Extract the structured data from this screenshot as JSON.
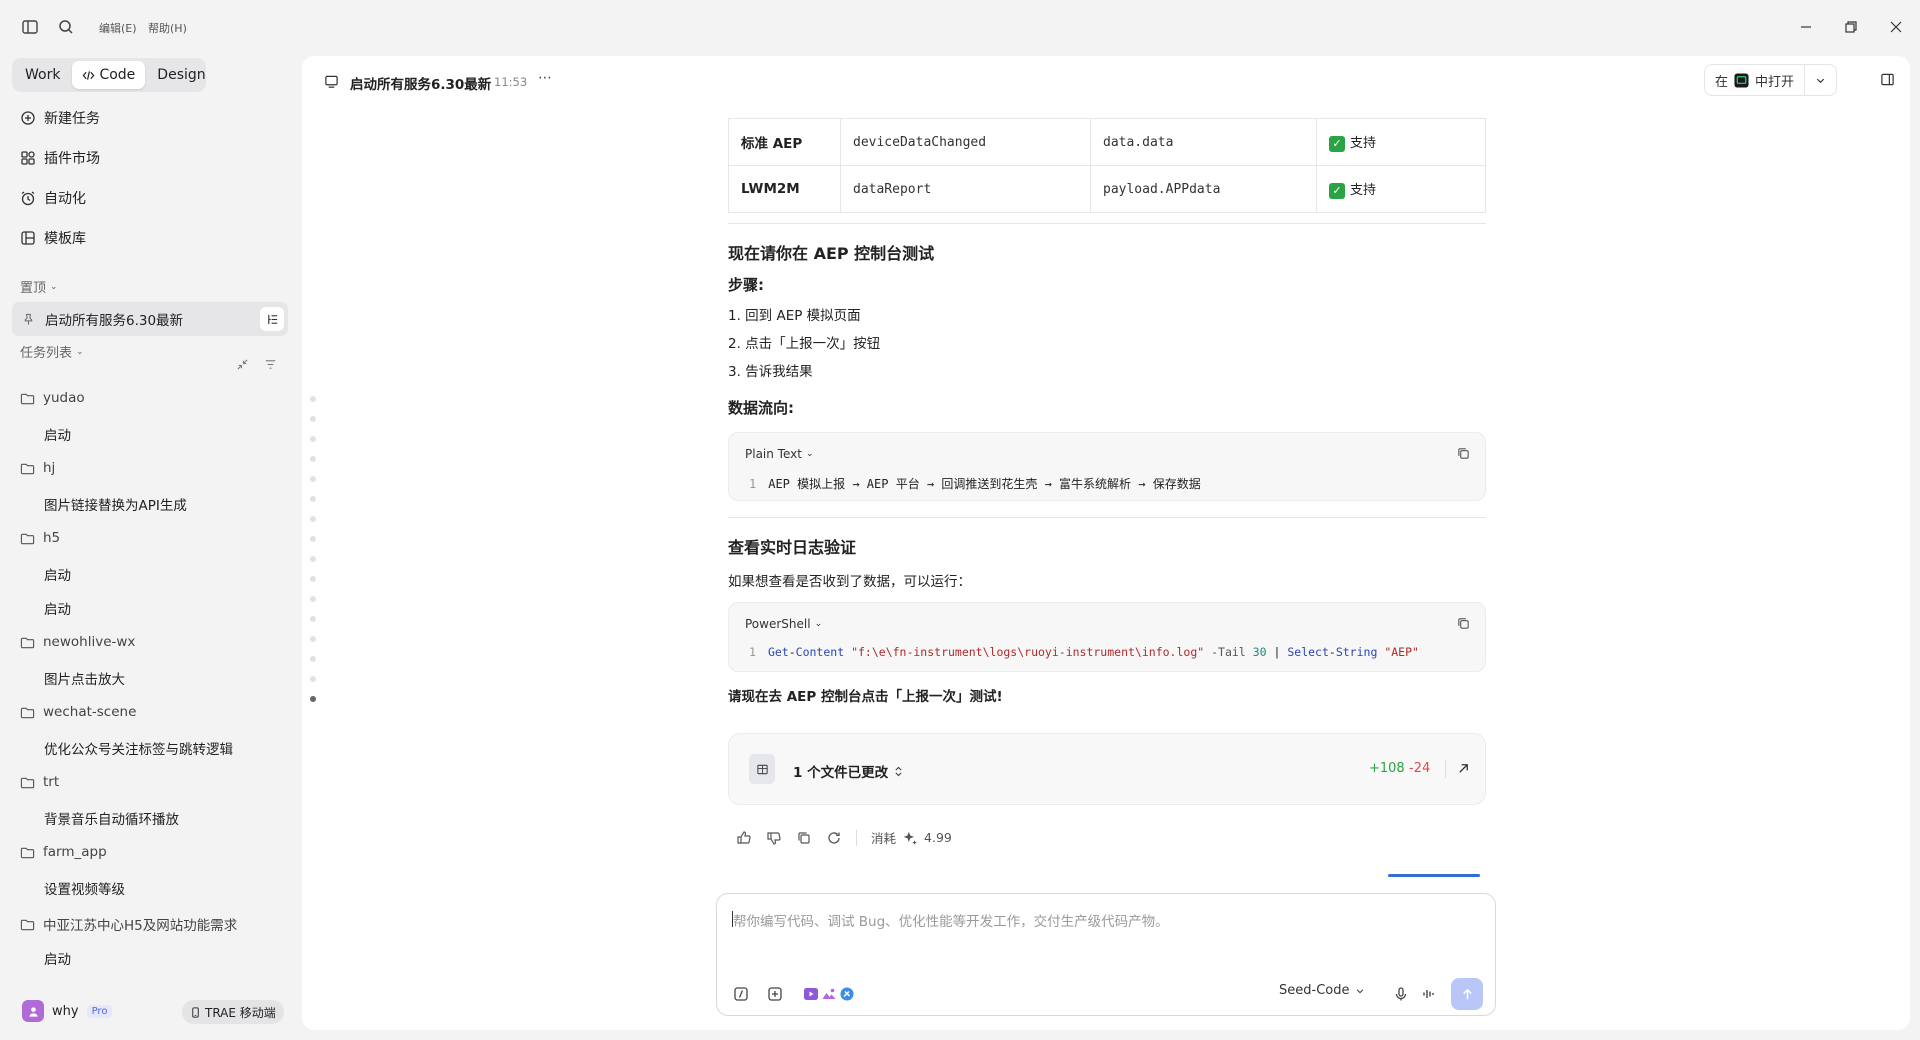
{
  "menu": {
    "edit": "编辑(E)",
    "help": "帮助(H)"
  },
  "modes": {
    "work": "Work",
    "code": "Code",
    "design": "Design"
  },
  "nav": {
    "new_task": "新建任务",
    "plugins": "插件市场",
    "automation": "自动化",
    "templates": "模板库"
  },
  "pinned": {
    "label": "置顶",
    "item": "启动所有服务6.30最新"
  },
  "task_list": {
    "label": "任务列表",
    "groups": [
      {
        "folder": "yudao",
        "tasks": [
          "启动"
        ]
      },
      {
        "folder": "hj",
        "tasks": [
          "图片链接替换为API生成"
        ]
      },
      {
        "folder": "h5",
        "tasks": [
          "启动",
          "启动"
        ]
      },
      {
        "folder": "newohlive-wx",
        "tasks": [
          "图片点击放大"
        ]
      },
      {
        "folder": "wechat-scene",
        "tasks": [
          "优化公众号关注标签与跳转逻辑"
        ]
      },
      {
        "folder": "trt",
        "tasks": [
          "背景音乐自动循环播放"
        ]
      },
      {
        "folder": "farm_app",
        "tasks": [
          "设置视频等级"
        ]
      },
      {
        "folder": "中亚江苏中心H5及网站功能需求",
        "tasks": [
          "启动"
        ]
      }
    ]
  },
  "user": {
    "name": "why",
    "badge": "Pro",
    "mobile": "TRAE 移动端"
  },
  "header": {
    "title": "启动所有服务6.30最新",
    "time": "11:53",
    "open_prefix": "在",
    "open_suffix": "中打开"
  },
  "table": {
    "rows": [
      {
        "proto": "标准 AEP",
        "method": "deviceDataChanged",
        "field": "data.data",
        "status": "支持"
      },
      {
        "proto": "LWM2M",
        "method": "dataReport",
        "field": "payload.APPdata",
        "status": "支持"
      }
    ]
  },
  "content": {
    "h_test": "现在请你在 AEP 控制台测试",
    "h_steps": "步骤:",
    "steps": [
      "1. 回到 AEP 模拟页面",
      "2. 点击「上报一次」按钮",
      "3. 告诉我结果"
    ],
    "h_flow": "数据流向:",
    "code1_lang": "Plain Text",
    "code1_line": "AEP 模拟上报 → AEP 平台 → 回调推送到花生壳 → 富牛系统解析 → 保存数据",
    "h_log": "查看实时日志验证",
    "log_intro": "如果想查看是否收到了数据，可以运行：",
    "code2_lang": "PowerShell",
    "code2": {
      "cmd1": "Get",
      "dash1": "-",
      "cmd1b": "Content",
      "path": "\"f:\\e\\fn-instrument\\logs\\ruoyi-instrument\\info.log\"",
      "param": "-Tail",
      "num": "30",
      "pipe": "|",
      "cmd2": "Select",
      "dash2": "-",
      "cmd2b": "String",
      "str": "\"AEP\""
    },
    "final": "请现在去 AEP 控制台点击「上报一次」测试!"
  },
  "files_changed": {
    "label": "1 个文件已更改",
    "added": "+108",
    "removed": "-24"
  },
  "cost": {
    "label": "消耗",
    "value": "4.99"
  },
  "input": {
    "placeholder": "帮你编写代码、调试 Bug、优化性能等开发工作，交付生产级代码产物。",
    "model": "Seed-Code"
  },
  "colors": {
    "accent": "#2f6fd6",
    "add": "#2aa345",
    "remove": "#e0474f"
  }
}
